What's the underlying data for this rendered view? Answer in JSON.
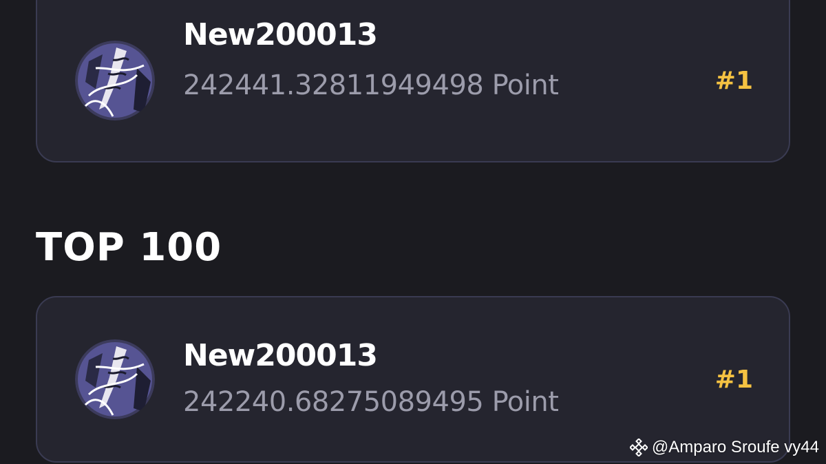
{
  "featured": {
    "username": "New200013",
    "points": "242441.32811949498 Point",
    "rank": "#1",
    "avatar_icon": "anime-character-avatar-icon"
  },
  "section": {
    "title": "TOP 100"
  },
  "leaderboard": [
    {
      "username": "New200013",
      "points": "242240.68275089495 Point",
      "rank": "#1",
      "avatar_icon": "anime-character-avatar-icon"
    }
  ],
  "watermark": {
    "text": "@Amparo Sroufe vy44",
    "icon": "binance-logo-icon"
  },
  "colors": {
    "background": "#1b1b20",
    "card": "#25252f",
    "card_border": "#3a3b52",
    "rank": "#f5c242",
    "points": "#9c9cab",
    "username": "#ffffff"
  }
}
